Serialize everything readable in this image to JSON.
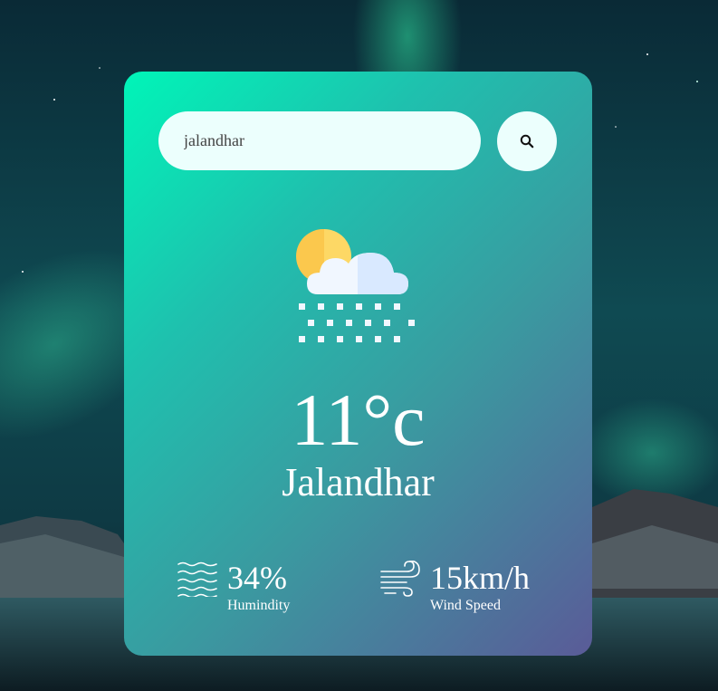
{
  "search": {
    "value": "jalandhar",
    "placeholder": ""
  },
  "weather": {
    "icon": "snow-cloud-sun-icon",
    "temperature": "11°c",
    "city": "Jalandhar"
  },
  "stats": {
    "humidity": {
      "value": "34%",
      "label": "Humindity",
      "icon": "humidity-waves-icon"
    },
    "wind": {
      "value": "15km/h",
      "label": "Wind Speed",
      "icon": "wind-icon"
    }
  },
  "colors": {
    "card_gradient_start": "#00f5b8",
    "card_gradient_end": "#5a5b98",
    "input_bg": "#ecfffd",
    "text": "#ffffff"
  }
}
